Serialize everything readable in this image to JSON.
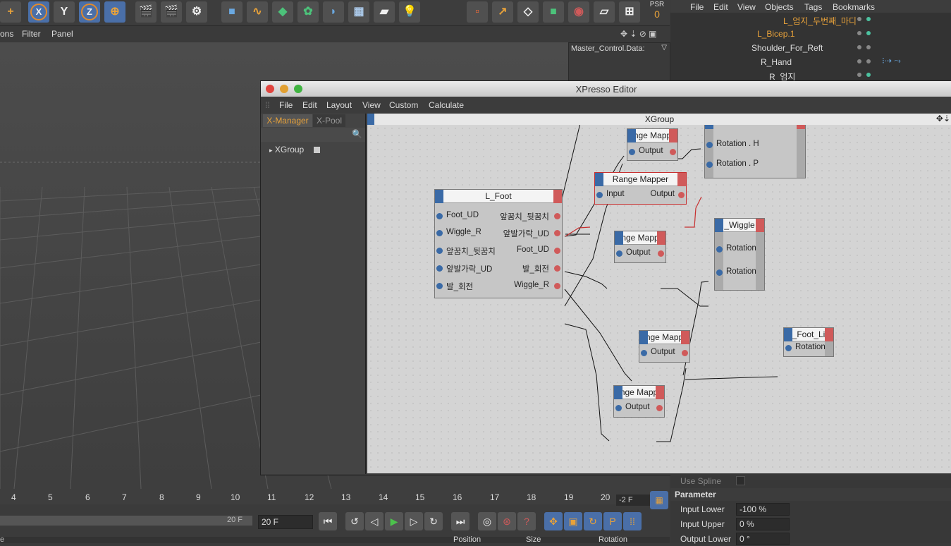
{
  "viewport_menu": {
    "items": [
      "ons",
      "Filter",
      "Panel"
    ]
  },
  "toolbar": {
    "axis_x": "X",
    "axis_y": "Y",
    "axis_z": "Z",
    "psr_label": "PSR",
    "psr_value": "0"
  },
  "object_manager": {
    "menu": [
      "File",
      "Edit",
      "View",
      "Objects",
      "Tags",
      "Bookmarks"
    ],
    "rows": [
      {
        "label": "L_엄지_두번째_마디"
      },
      {
        "label": "L_Bicep.1"
      },
      {
        "label": "Shoulder_For_Reft"
      },
      {
        "label": "R_Hand"
      },
      {
        "label": "R_엄지"
      }
    ],
    "data_label": "Master_Control.Data:"
  },
  "xpresso": {
    "title": "XPresso Editor",
    "menu": [
      "File",
      "Edit",
      "Layout",
      "View",
      "Custom",
      "Calculate"
    ],
    "tabs": [
      "X-Manager",
      "X-Pool"
    ],
    "tree_item": "XGroup",
    "canvas_title": "XGroup",
    "nodes": {
      "lfoot": {
        "title": "L_Foot",
        "inputs": [
          "Foot_UD",
          "Wiggle_R",
          "앞꿈치_뒷꿈치",
          "앞발가락_UD",
          "발_회전"
        ],
        "outputs": [
          "앞꿈치_뒷꿈치",
          "앞발가락_UD",
          "Foot_UD",
          "발_회전",
          "Wiggle_R"
        ]
      },
      "rm_top": {
        "title": "nge Mapp",
        "output": "Output"
      },
      "rm_sel": {
        "title": "Range Mapper",
        "input": "Input",
        "output": "Output"
      },
      "rot_top": {
        "ports": [
          "Rotation . H",
          "Rotation . P"
        ]
      },
      "rm_mid": {
        "title": "nge Mapp",
        "output": "Output"
      },
      "wiggle": {
        "title": "_Wiggle",
        "ports": [
          "Rotation",
          "Rotation"
        ]
      },
      "rm_low": {
        "title": "nge Mapp",
        "output": "Output"
      },
      "footli": {
        "title": "_Foot_Li",
        "port": "Rotation"
      },
      "rm_bot": {
        "title": "nge Mapp",
        "output": "Output"
      }
    }
  },
  "timeline": {
    "ticks": [
      "4",
      "5",
      "6",
      "7",
      "8",
      "9",
      "10",
      "11",
      "12",
      "13",
      "14",
      "15",
      "16",
      "17",
      "18",
      "19",
      "20"
    ],
    "frame_display": "-2 F",
    "end_field_a": "20 F",
    "end_field_b": "20 F",
    "coord_headers": [
      "Position",
      "Size",
      "Rotation"
    ],
    "left_cut": "e"
  },
  "attributes": {
    "use_spline": "Use Spline",
    "section": "Parameter",
    "fields": [
      {
        "label": "Input Lower",
        "value": "-100 %"
      },
      {
        "label": "Input Upper",
        "value": "0 %"
      },
      {
        "label": "Output Lower",
        "value": "0 °"
      }
    ]
  }
}
